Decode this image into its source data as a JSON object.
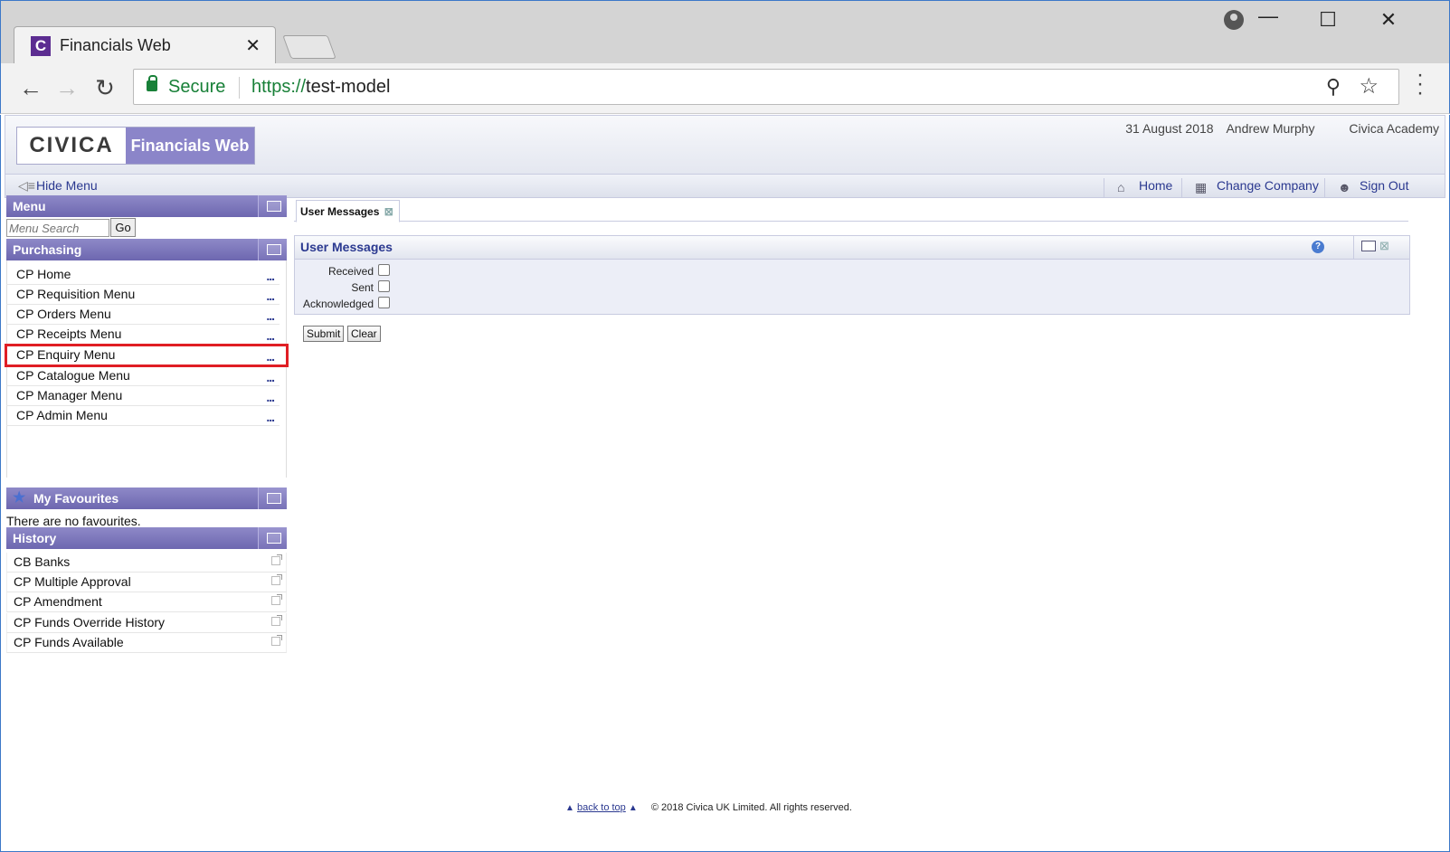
{
  "browser": {
    "tab_title": "Financials Web",
    "tab_favicon": "C",
    "tab_close": "✕",
    "secure_label": "Secure",
    "url_scheme": "https://",
    "url_host": "test-model"
  },
  "header": {
    "logo_brand": "CIVICA",
    "logo_product": "Financials Web",
    "date": "31 August 2018",
    "user": "Andrew Murphy",
    "organisation": "Civica Academy"
  },
  "app_bar": {
    "hide_menu": "Hide Menu",
    "home": "Home",
    "change_company": "Change Company",
    "sign_out": "Sign Out"
  },
  "sidebar": {
    "menu_title": "Menu",
    "search_placeholder": "Menu Search",
    "go_label": "Go",
    "purchasing_title": "Purchasing",
    "purchasing_items": [
      "CP Home",
      "CP Requisition Menu",
      "CP Orders Menu",
      "CP Receipts Menu",
      "CP Enquiry Menu",
      "CP Catalogue Menu",
      "CP Manager Menu",
      "CP Admin Menu"
    ],
    "more_label": "...",
    "favourites_title": "My Favourites",
    "no_favourites": "There are no favourites.",
    "history_title": "History",
    "history_items": [
      "CB Banks",
      "CP Multiple Approval",
      "CP Amendment",
      "CP Funds Override History",
      "CP Funds Available"
    ]
  },
  "main": {
    "tab_label": "User Messages",
    "panel_title": "User Messages",
    "help_label": "?",
    "filters": [
      "Received",
      "Sent",
      "Acknowledged"
    ],
    "submit_label": "Submit",
    "clear_label": "Clear"
  },
  "footer": {
    "back_to_top": "back to top",
    "copyright": "© 2018 Civica UK Limited. All rights reserved."
  },
  "colors": {
    "accent_purple": "#8b85c9",
    "link_blue": "#2b3990",
    "highlight_red": "#e01e24",
    "secure_green": "#188038"
  },
  "icons": [
    "back-icon",
    "forward-icon",
    "reload-icon",
    "lock-icon",
    "zoom-icon",
    "star-icon",
    "home-icon",
    "company-icon",
    "sign-out-icon",
    "help-icon",
    "star-favourite-icon"
  ]
}
